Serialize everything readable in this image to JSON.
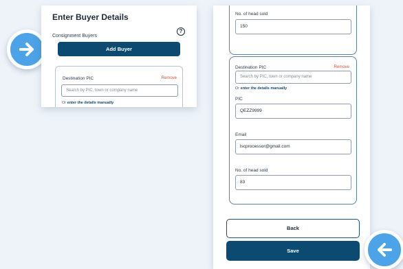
{
  "left_panel": {
    "title": "Enter Buyer Details",
    "subtitle": "Consignment Buyers",
    "help_glyph": "?",
    "add_buyer_label": "Add Buyer",
    "card": {
      "label": "Destination PIC",
      "remove_label": "Remove",
      "placeholder": "Search by PIC, town or company name",
      "manual_prefix": "Or ",
      "manual_link": "enter the details manually"
    }
  },
  "right_panel": {
    "top_card": {
      "head_label": "No. of head sold",
      "head_value": "150"
    },
    "bottom_card": {
      "label": "Destination PIC",
      "remove_label": "Remove",
      "placeholder": "Search by PIC, town or company name",
      "manual_prefix": "Or ",
      "manual_link": "enter the details manually",
      "pic_label": "PIC",
      "pic_value": "QEZZ9999",
      "email_label": "Email",
      "email_value": "lscprocessor@gmail.com",
      "head_label": "No. of head sold",
      "head_value": "83"
    },
    "back_label": "Back",
    "save_label": "Save"
  },
  "icons": {
    "right": "arrow-right-icon",
    "left": "arrow-left-icon",
    "help": "question-circle-icon"
  },
  "colors": {
    "primary": "#0c4a72",
    "accent_arrow": "#4da3e8",
    "remove": "#d0523a",
    "background": "#eef3f9"
  }
}
